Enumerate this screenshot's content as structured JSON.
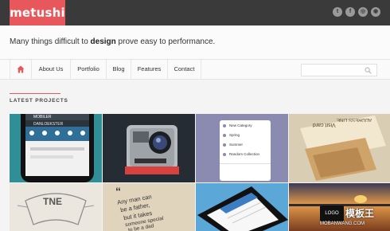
{
  "header": {
    "logo_text": "metushi",
    "social_icons": [
      "twitter-icon",
      "facebook-icon",
      "instagram-icon",
      "rss-icon"
    ],
    "accent_color": "#e8575c"
  },
  "tagline": {
    "before": "Many things difficult to ",
    "emphasis": "design",
    "after": " prove easy to performance."
  },
  "nav": {
    "items": [
      {
        "label": "About Us"
      },
      {
        "label": "Portfolio"
      },
      {
        "label": "Blog"
      },
      {
        "label": "Features"
      },
      {
        "label": "Contact"
      }
    ],
    "search_placeholder": ""
  },
  "section": {
    "title": "LATEST PROJECTS"
  },
  "tiles": {
    "t1": {
      "line1": "MOBILER",
      "line2": "DANLOEKSTER"
    },
    "t3": {
      "items": [
        "New Category",
        "Spring",
        "Summer",
        "Random Collection"
      ]
    },
    "t4": {
      "line1": "Visit card",
      "line2": "ADDRESS LINE"
    },
    "t5": {
      "text": "TNE"
    },
    "t6": {
      "line1": "Any man can",
      "line2": "be a father,",
      "line3": "but it takes",
      "line4": "someone special",
      "line5": "to be a dad"
    }
  },
  "watermark": {
    "logo": "LOGO",
    "text": "模板王",
    "url": "MOBANWANG.COM"
  }
}
